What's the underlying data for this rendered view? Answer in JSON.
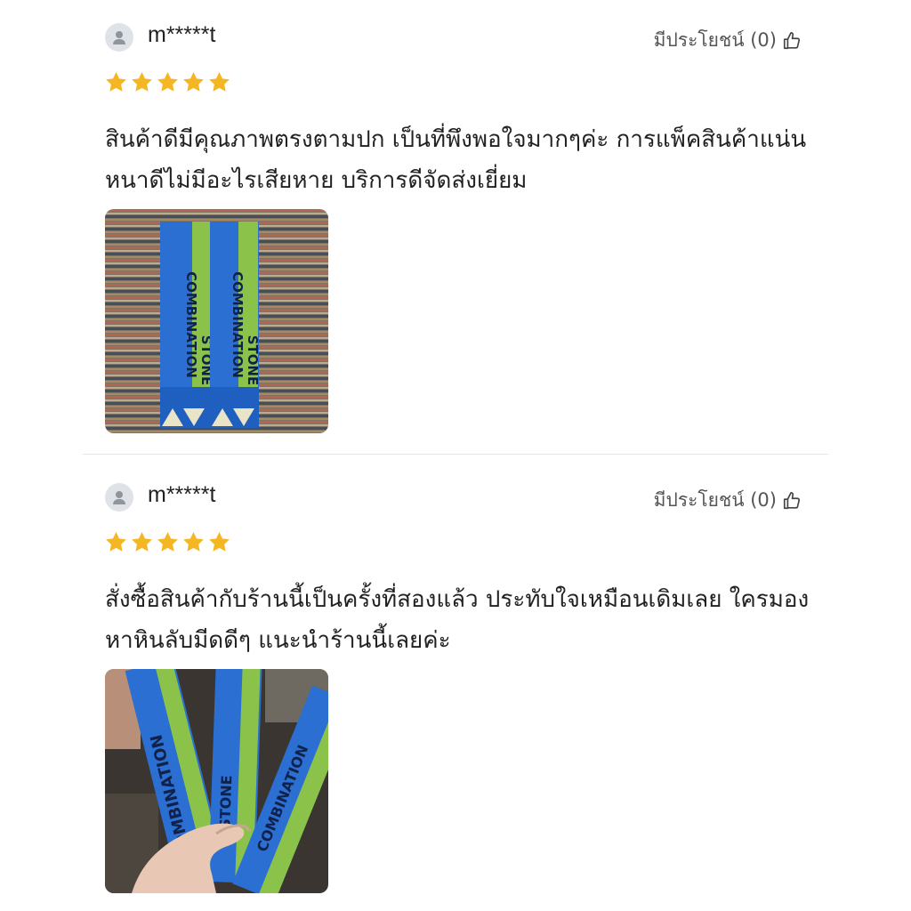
{
  "reviews": [
    {
      "username": "m*****t",
      "helpful_label": "มีประโยชน์ (0)",
      "rating": 5,
      "text": "สินค้าดีมีคุณภาพตรงตามปก เป็นที่พึงพอใจมากๆค่ะ การแพ็คสินค้าแน่นหนาดีไม่มีอะไรเสียหาย บริการดีจัดส่งเยี่ยม",
      "photo": {
        "brand": "COMBINATION",
        "product": "STONE"
      }
    },
    {
      "username": "m*****t",
      "helpful_label": "มีประโยชน์ (0)",
      "rating": 5,
      "text": "สั่งซื้อสินค้ากับร้านนี้เป็นครั้งที่สองแล้ว ประทับใจเหมือนเดิมเลย ใครมองหาหินลับมีดดีๆ แนะนำร้านนี้เลยค่ะ",
      "photo": {
        "brand": "COMBINATION",
        "product": "STONE"
      }
    }
  ],
  "colors": {
    "star": "#f5b623",
    "box_blue": "#2a6fd1",
    "box_green": "#8bc34a"
  },
  "icons": {
    "avatar": "user-avatar-icon",
    "helpful": "thumbs-up-icon",
    "star": "star-icon"
  }
}
